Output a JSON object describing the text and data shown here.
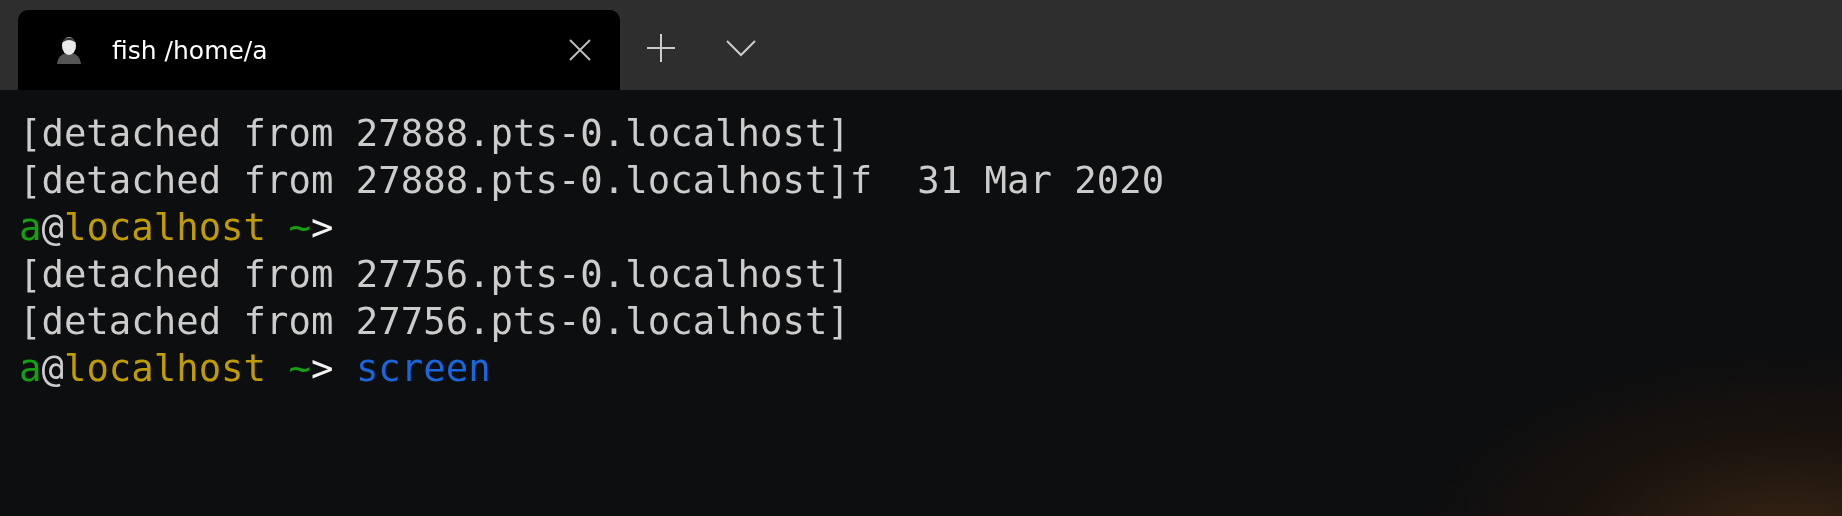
{
  "tabs": [
    {
      "title": "fish /home/a",
      "selected": true
    }
  ],
  "terminal": {
    "lines": [
      {
        "segments": [
          {
            "text": "[detached from 27888.pts-0.localhost]",
            "color": "#cccccc"
          }
        ]
      },
      {
        "segments": [
          {
            "text": "[detached from 27888.pts-0.localhost]f  31 Mar 2020",
            "color": "#cccccc"
          }
        ]
      },
      {
        "segments": [
          {
            "text": "a",
            "color": "#13a10e"
          },
          {
            "text": "@",
            "color": "#cccccc"
          },
          {
            "text": "localhost",
            "color": "#c19c00"
          },
          {
            "text": " ~",
            "color": "#13a10e"
          },
          {
            "text": ">",
            "color": "#f2f2f2"
          }
        ]
      },
      {
        "segments": [
          {
            "text": "[detached from 27756.pts-0.localhost]",
            "color": "#cccccc"
          }
        ]
      },
      {
        "segments": [
          {
            "text": "[detached from 27756.pts-0.localhost]",
            "color": "#cccccc"
          }
        ]
      },
      {
        "segments": [
          {
            "text": "a",
            "color": "#13a10e"
          },
          {
            "text": "@",
            "color": "#cccccc"
          },
          {
            "text": "localhost",
            "color": "#c19c00"
          },
          {
            "text": " ~",
            "color": "#13a10e"
          },
          {
            "text": ">",
            "color": "#f2f2f2"
          },
          {
            "text": " screen",
            "color": "#1a66dd"
          }
        ]
      }
    ]
  }
}
